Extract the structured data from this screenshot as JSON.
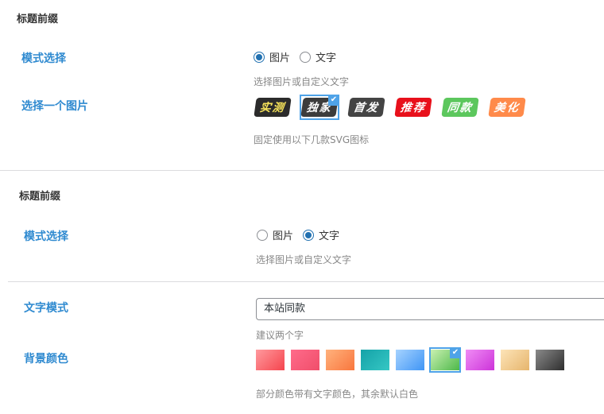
{
  "section1": {
    "title": "标题前缀",
    "mode_label": "模式选择",
    "radio_image": "图片",
    "radio_text": "文字",
    "mode_hint": "选择图片或自定义文字",
    "image_label": "选择一个图片",
    "badges": [
      {
        "text": "实测",
        "bg": "#2b2b2b",
        "color": "#f5e25a",
        "selected": false
      },
      {
        "text": "独家",
        "bg": "#3c3c3c",
        "color": "#ffffff",
        "selected": true
      },
      {
        "text": "首发",
        "bg": "#444444",
        "color": "#ffffff",
        "selected": false
      },
      {
        "text": "推荐",
        "bg": "#e8101b",
        "color": "#ffffff",
        "selected": false
      },
      {
        "text": "同款",
        "bg": "#5cc75d",
        "color": "#ffffff",
        "selected": false
      },
      {
        "text": "美化",
        "bg": "#ff8a4a",
        "color": "#ffffff",
        "selected": false
      }
    ],
    "image_hint": "固定使用以下几款SVG图标"
  },
  "section2": {
    "title": "标题前缀",
    "mode_label": "模式选择",
    "radio_image": "图片",
    "radio_text": "文字",
    "mode_hint": "选择图片或自定义文字",
    "text_mode_label": "文字模式",
    "text_mode_value": "本站同款",
    "text_mode_hint": "建议两个字",
    "bg_color_label": "背景颜色",
    "swatches": [
      {
        "from": "#ff9a9e",
        "to": "#f5444d",
        "selected": false
      },
      {
        "from": "#ff6b8b",
        "to": "#f04e6a",
        "selected": false
      },
      {
        "from": "#ffb27d",
        "to": "#f9763d",
        "selected": false
      },
      {
        "from": "#14a2a8",
        "to": "#36c7c4",
        "selected": false
      },
      {
        "from": "#a6d3ff",
        "to": "#3f95f5",
        "selected": false
      },
      {
        "from": "#c9f0b0",
        "to": "#4db84a",
        "selected": true
      },
      {
        "from": "#f08cf5",
        "to": "#cc33d9",
        "selected": false
      },
      {
        "from": "#fde4b8",
        "to": "#e6b56c",
        "selected": false
      },
      {
        "from": "#8a8a8a",
        "to": "#2e2e2e",
        "selected": false
      }
    ],
    "bg_color_hint": "部分颜色带有文字颜色，其余默认白色"
  }
}
